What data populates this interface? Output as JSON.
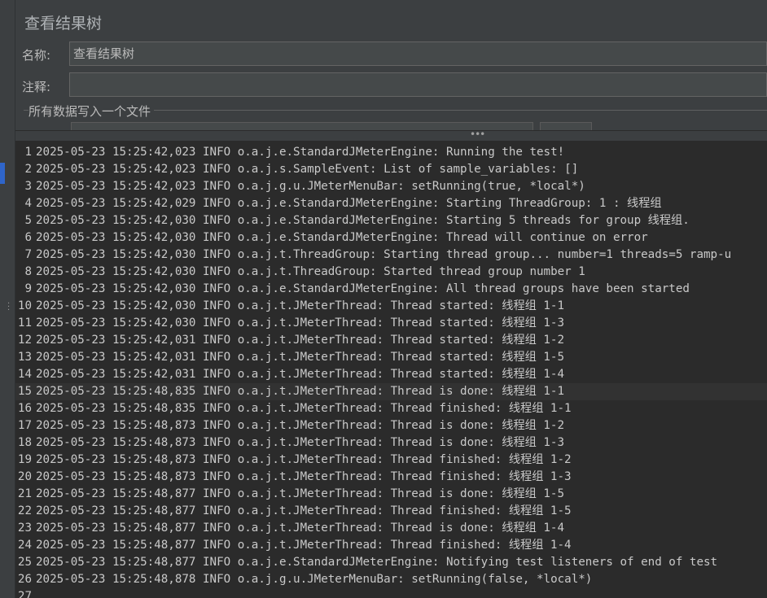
{
  "panel": {
    "title": "查看结果树",
    "name_label": "名称:",
    "name_value": "查看结果树",
    "comment_label": "注释:",
    "comment_value": "",
    "write_all_label": "所有数据写入一个文件"
  },
  "log": {
    "highlighted_line": 15,
    "lines": [
      {
        "n": "1",
        "t": "2025-05-23 15:25:42,023 INFO o.a.j.e.StandardJMeterEngine: Running the test!"
      },
      {
        "n": "2",
        "t": "2025-05-23 15:25:42,023 INFO o.a.j.s.SampleEvent: List of sample_variables: []"
      },
      {
        "n": "3",
        "t": "2025-05-23 15:25:42,023 INFO o.a.j.g.u.JMeterMenuBar: setRunning(true, *local*)"
      },
      {
        "n": "4",
        "t": "2025-05-23 15:25:42,029 INFO o.a.j.e.StandardJMeterEngine: Starting ThreadGroup: 1 : 线程组"
      },
      {
        "n": "5",
        "t": "2025-05-23 15:25:42,030 INFO o.a.j.e.StandardJMeterEngine: Starting 5 threads for group 线程组."
      },
      {
        "n": "6",
        "t": "2025-05-23 15:25:42,030 INFO o.a.j.e.StandardJMeterEngine: Thread will continue on error"
      },
      {
        "n": "7",
        "t": "2025-05-23 15:25:42,030 INFO o.a.j.t.ThreadGroup: Starting thread group... number=1 threads=5 ramp-u"
      },
      {
        "n": "8",
        "t": "2025-05-23 15:25:42,030 INFO o.a.j.t.ThreadGroup: Started thread group number 1"
      },
      {
        "n": "9",
        "t": "2025-05-23 15:25:42,030 INFO o.a.j.e.StandardJMeterEngine: All thread groups have been started"
      },
      {
        "n": "10",
        "t": "2025-05-23 15:25:42,030 INFO o.a.j.t.JMeterThread: Thread started: 线程组 1-1"
      },
      {
        "n": "11",
        "t": "2025-05-23 15:25:42,030 INFO o.a.j.t.JMeterThread: Thread started: 线程组 1-3"
      },
      {
        "n": "12",
        "t": "2025-05-23 15:25:42,031 INFO o.a.j.t.JMeterThread: Thread started: 线程组 1-2"
      },
      {
        "n": "13",
        "t": "2025-05-23 15:25:42,031 INFO o.a.j.t.JMeterThread: Thread started: 线程组 1-5"
      },
      {
        "n": "14",
        "t": "2025-05-23 15:25:42,031 INFO o.a.j.t.JMeterThread: Thread started: 线程组 1-4"
      },
      {
        "n": "15",
        "t": "2025-05-23 15:25:48,835 INFO o.a.j.t.JMeterThread: Thread is done: 线程组 1-1"
      },
      {
        "n": "16",
        "t": "2025-05-23 15:25:48,835 INFO o.a.j.t.JMeterThread: Thread finished: 线程组 1-1"
      },
      {
        "n": "17",
        "t": "2025-05-23 15:25:48,873 INFO o.a.j.t.JMeterThread: Thread is done: 线程组 1-2"
      },
      {
        "n": "18",
        "t": "2025-05-23 15:25:48,873 INFO o.a.j.t.JMeterThread: Thread is done: 线程组 1-3"
      },
      {
        "n": "19",
        "t": "2025-05-23 15:25:48,873 INFO o.a.j.t.JMeterThread: Thread finished: 线程组 1-2"
      },
      {
        "n": "20",
        "t": "2025-05-23 15:25:48,873 INFO o.a.j.t.JMeterThread: Thread finished: 线程组 1-3"
      },
      {
        "n": "21",
        "t": "2025-05-23 15:25:48,877 INFO o.a.j.t.JMeterThread: Thread is done: 线程组 1-5"
      },
      {
        "n": "22",
        "t": "2025-05-23 15:25:48,877 INFO o.a.j.t.JMeterThread: Thread finished: 线程组 1-5"
      },
      {
        "n": "23",
        "t": "2025-05-23 15:25:48,877 INFO o.a.j.t.JMeterThread: Thread is done: 线程组 1-4"
      },
      {
        "n": "24",
        "t": "2025-05-23 15:25:48,877 INFO o.a.j.t.JMeterThread: Thread finished: 线程组 1-4"
      },
      {
        "n": "25",
        "t": "2025-05-23 15:25:48,877 INFO o.a.j.e.StandardJMeterEngine: Notifying test listeners of end of test"
      },
      {
        "n": "26",
        "t": "2025-05-23 15:25:48,878 INFO o.a.j.g.u.JMeterMenuBar: setRunning(false, *local*)"
      },
      {
        "n": "27",
        "t": ""
      }
    ]
  }
}
